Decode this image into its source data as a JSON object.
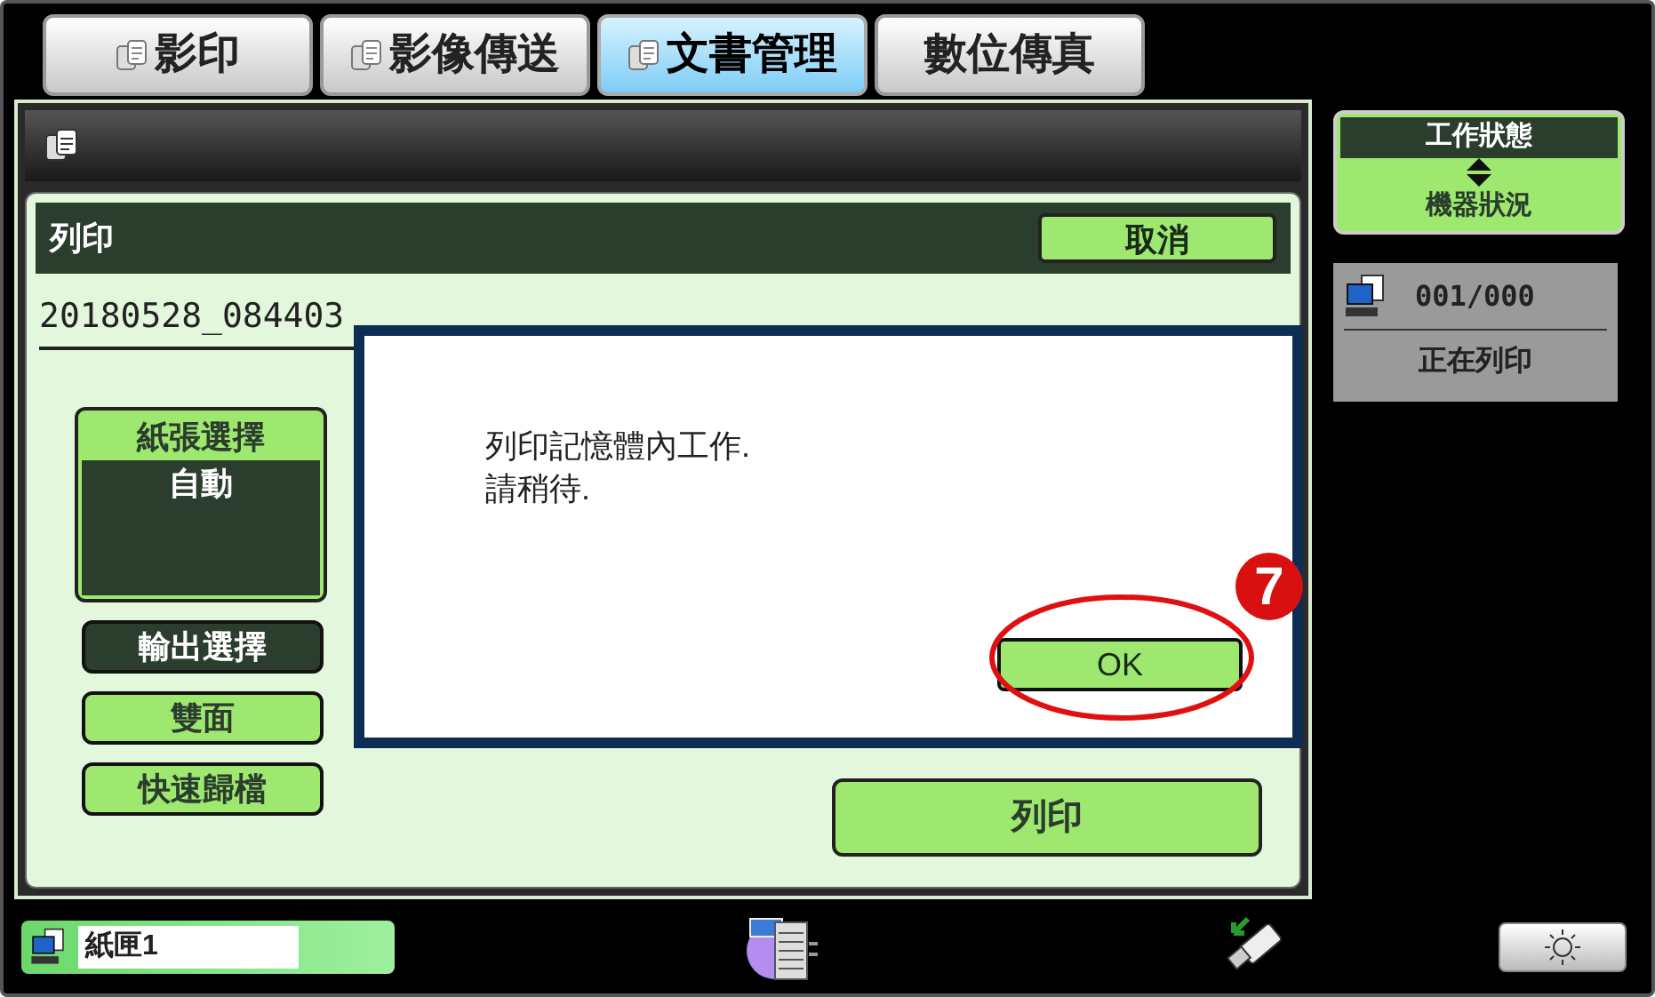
{
  "tabs": [
    {
      "label": "影印",
      "selected": false,
      "icon": true
    },
    {
      "label": "影像傳送",
      "selected": false,
      "icon": true
    },
    {
      "label": "文書管理",
      "selected": true,
      "icon": true
    },
    {
      "label": "數位傳真",
      "selected": false,
      "icon": false
    }
  ],
  "print_panel": {
    "title": "列印",
    "cancel_button": "取消",
    "file_name": "20180528_084403",
    "paper_select": {
      "label": "紙張選擇",
      "value": "自動"
    },
    "option_buttons": [
      {
        "label": "輸出選擇",
        "selected": true
      },
      {
        "label": "雙面",
        "selected": false
      },
      {
        "label": "快速歸檔",
        "selected": false
      }
    ],
    "print_button": "列印"
  },
  "dialog": {
    "lines": [
      "列印記憶體內工作.",
      "請稍待."
    ],
    "ok_button": "OK"
  },
  "annotation": {
    "number": "7"
  },
  "status_panel": {
    "toggle_top": "工作狀態",
    "toggle_bottom": "機器狀況",
    "job": {
      "count": "001/000",
      "status": "正在列印"
    }
  },
  "bottom_bar": {
    "tray": "紙匣1"
  }
}
